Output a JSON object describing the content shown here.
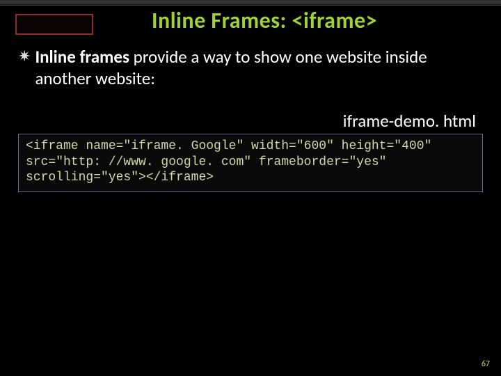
{
  "title": "Inline Frames: <iframe>",
  "bullet": {
    "lead": "Inline frames",
    "rest": " provide a way to show one website inside another website:"
  },
  "filename": "iframe-demo. html",
  "code": "<iframe name=\"iframe. Google\" width=\"600\" height=\"400\" src=\"http: //www. google. com\" frameborder=\"yes\" scrolling=\"yes\"></iframe>",
  "page_number": "67"
}
